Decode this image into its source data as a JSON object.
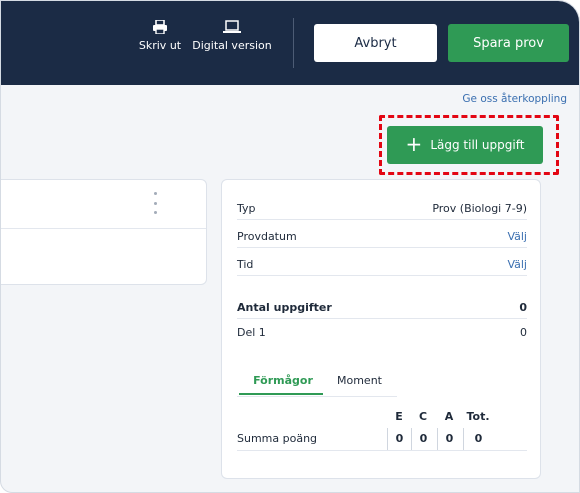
{
  "header": {
    "print_label": "Skriv ut",
    "digital_label": "Digital version",
    "cancel_label": "Avbryt",
    "save_label": "Spara prov"
  },
  "feedback_label": "Ge oss återkoppling",
  "add_task_label": "Lägg till uppgift",
  "summary": {
    "rows": [
      {
        "label": "Typ",
        "value": "Prov (Biologi 7-9)"
      },
      {
        "label": "Provdatum",
        "value": "Välj"
      },
      {
        "label": "Tid",
        "value": "Välj"
      }
    ],
    "task_count_label": "Antal uppgifter",
    "task_count_value": "0",
    "part_label": "Del 1",
    "part_value": "0",
    "tabs": [
      "Förmågor",
      "Moment"
    ],
    "score_headers": [
      "E",
      "C",
      "A",
      "Tot."
    ],
    "score_label": "Summa poäng",
    "score_values": [
      "0",
      "0",
      "0",
      "0"
    ]
  },
  "colors": {
    "header_bg": "#1b2b45",
    "primary_green": "#2f9a55",
    "link_blue": "#3a6fb0",
    "highlight_red": "#e30613"
  }
}
